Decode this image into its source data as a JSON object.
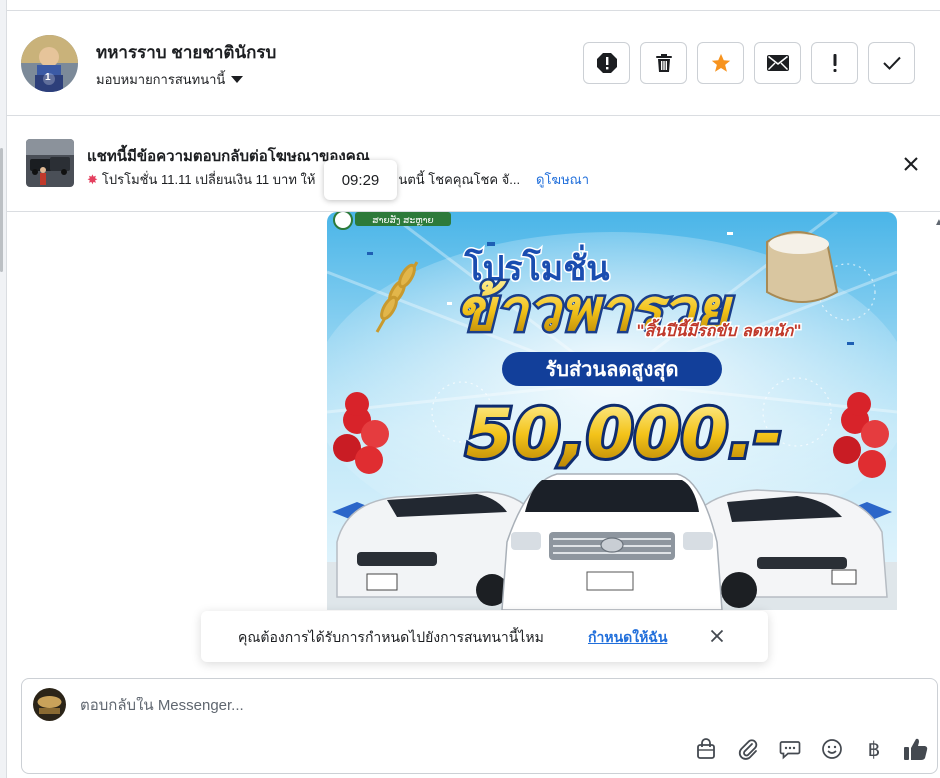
{
  "header": {
    "contact_name": "ทหารราบ ชายชาตินักรบ",
    "assign_label": "มอบหมายการสนทนานี้",
    "avatar_badge": "1",
    "actions": [
      {
        "name": "spam-button",
        "icon": "octagon-alert-icon"
      },
      {
        "name": "delete-button",
        "icon": "trash-icon"
      },
      {
        "name": "star-button",
        "icon": "star-icon"
      },
      {
        "name": "mark-unread-button",
        "icon": "envelope-icon"
      },
      {
        "name": "follow-up-button",
        "icon": "exclamation-icon"
      },
      {
        "name": "mark-done-button",
        "icon": "checkmark-icon"
      }
    ],
    "colors": {
      "star": "#f7931e"
    }
  },
  "ad_banner": {
    "title": "แชทนี้มีข้อความตอบกลับต่อโฆษณาของคุณ",
    "description_start": "โปรโมชั่น 11.11 เปลี่ยนเงิน 11 บาท ให้",
    "description_end": "นตนี้ โชคคุณโชค จั...",
    "view_ad": "ดูโฆษณา",
    "burst_icon": "sparkle-burst-icon"
  },
  "tooltip": {
    "time": "09:29"
  },
  "promo": {
    "logo_text": "ສາຍສັງ ສະຫຼາຍ",
    "headline_small": "โปรโมชั่น",
    "headline_big": "ข้าวพารวย",
    "tagline": "\"สิ้นปีนี้มีรถขับ ลดหนัก\"",
    "discount_label": "รับส่วนลดสูงสุด",
    "amount": "50,000.-"
  },
  "assign_prompt": {
    "question": "คุณต้องการได้รับการกำหนดไปยังการสนทนานี้ไหม",
    "link": "กำหนดให้ฉัน"
  },
  "composer": {
    "placeholder": "ตอบกลับใน Messenger...",
    "tools": [
      "shopping-bag-icon",
      "paperclip-icon",
      "saved-reply-icon",
      "emoji-icon",
      "baht-icon",
      "thumbs-up-icon"
    ],
    "baht_symbol": "฿"
  }
}
